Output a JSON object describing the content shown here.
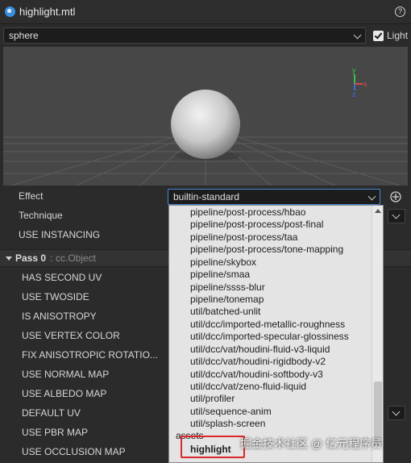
{
  "titlebar": {
    "title": "highlight.mtl",
    "help_glyph": "?"
  },
  "preview": {
    "mesh_select": "sphere",
    "light_checked": true,
    "light_label": "Light",
    "gizmo": {
      "y": "y",
      "x": "x",
      "z": "z"
    }
  },
  "inspector": {
    "effect_label": "Effect",
    "effect_value": "builtin-standard",
    "technique_label": "Technique",
    "use_instancing_label": "USE INSTANCING",
    "pass": {
      "title": "Pass 0",
      "type": "cc.Object"
    },
    "defines": [
      "HAS SECOND UV",
      "USE TWOSIDE",
      "IS ANISOTROPY",
      "USE VERTEX COLOR",
      "FIX ANISOTROPIC ROTATIO...",
      "USE NORMAL MAP",
      "USE ALBEDO MAP",
      "DEFAULT UV",
      "USE PBR MAP",
      "USE OCCLUSION MAP"
    ]
  },
  "effect_dropdown": {
    "items": [
      "pipeline/post-process/hbao",
      "pipeline/post-process/post-final",
      "pipeline/post-process/taa",
      "pipeline/post-process/tone-mapping",
      "pipeline/skybox",
      "pipeline/smaa",
      "pipeline/ssss-blur",
      "pipeline/tonemap",
      "util/batched-unlit",
      "util/dcc/imported-metallic-roughness",
      "util/dcc/imported-specular-glossiness",
      "util/dcc/vat/houdini-fluid-v3-liquid",
      "util/dcc/vat/houdini-rigidbody-v2",
      "util/dcc/vat/houdini-softbody-v3",
      "util/dcc/vat/zeno-fluid-liquid",
      "util/profiler",
      "util/sequence-anim",
      "util/splash-screen"
    ],
    "group_label": "assets",
    "highlighted_item": "highlight"
  },
  "watermark": "掘金技术社区 @ 亿元程序员"
}
